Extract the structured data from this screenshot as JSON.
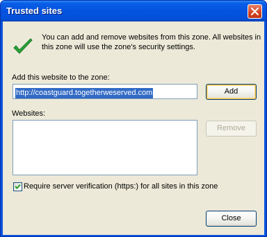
{
  "window": {
    "title": "Trusted sites"
  },
  "info": {
    "line1": "You can add and remove websites from this zone. All websites in",
    "line2": "this zone will use the zone's security settings."
  },
  "add": {
    "label": "Add this website to the zone:",
    "value": "http://coastguard.togetherweserved.com",
    "button": "Add"
  },
  "websites": {
    "label": "Websites:",
    "items": [],
    "remove_button": "Remove"
  },
  "https": {
    "label": "Require server verification (https:) for all sites in this zone",
    "checked": true
  },
  "footer": {
    "close_button": "Close"
  },
  "colors": {
    "title_bar": "#0453e0",
    "dialog_bg": "#ece9d8",
    "selection": "#316ac5",
    "check_green": "#2aa43a"
  },
  "icons": {
    "info": "green-checkmark-icon",
    "close": "close-icon",
    "checkbox": "checkmark-icon"
  }
}
